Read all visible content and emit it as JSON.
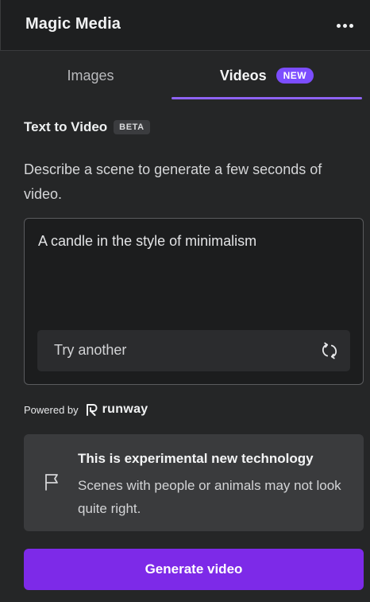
{
  "header": {
    "title": "Magic Media"
  },
  "tabs": [
    {
      "label": "Images",
      "active": false
    },
    {
      "label": "Videos",
      "active": true,
      "badge": "NEW"
    }
  ],
  "section": {
    "title": "Text to Video",
    "badge": "BETA",
    "description": "Describe a scene to generate a few seconds of video."
  },
  "prompt": {
    "value": "A candle in the style of minimalism",
    "try_another_label": "Try another"
  },
  "powered_by": {
    "label": "Powered by",
    "brand": "runway"
  },
  "notice": {
    "title": "This is experimental new technology",
    "body": "Scenes with people or animals may not look quite right."
  },
  "actions": {
    "generate_label": "Generate video"
  },
  "colors": {
    "accent": "#7d2ae8",
    "tab_indicator": "#8e63f5",
    "badge_new": "#7c4dff",
    "panel_bg": "#252627"
  },
  "icons": {
    "more": "more-horizontal-icon",
    "refresh": "refresh-icon",
    "flag": "flag-icon",
    "runway": "runway-logo-icon"
  }
}
